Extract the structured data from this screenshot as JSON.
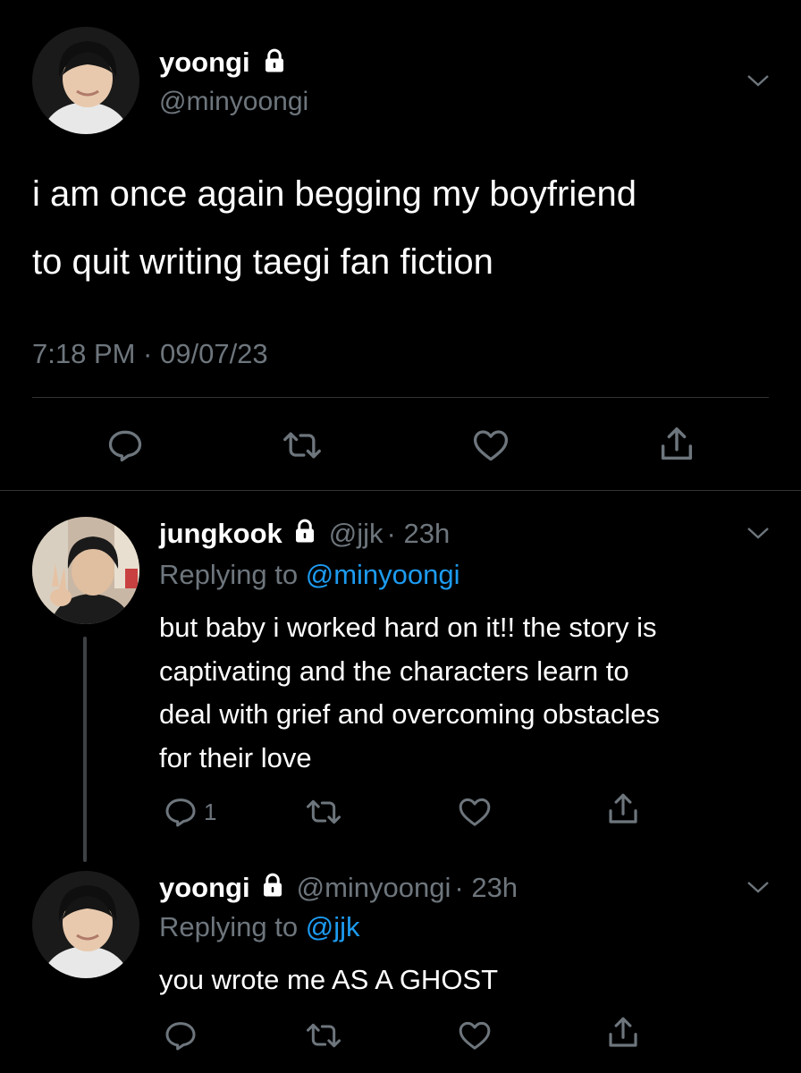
{
  "main_tweet": {
    "display_name": "yoongi",
    "handle": "@minyoongi",
    "text_line1": "i am once again begging my boyfriend",
    "text_line2": "to quit writing taegi fan fiction",
    "timestamp": "7:18 PM · 09/07/23"
  },
  "reply1": {
    "display_name": "jungkook",
    "handle": "@jjk",
    "time": "· 23h",
    "replying_prefix": "Replying to ",
    "replying_handle": "@minyoongi",
    "text_lines": [
      "but baby i worked hard on it!! the story is",
      "captivating and the characters learn to",
      "deal with grief and overcoming obstacles",
      "for their love"
    ],
    "reply_count": "1"
  },
  "reply2": {
    "display_name": "yoongi",
    "handle": "@minyoongi",
    "time": "· 23h",
    "replying_prefix": "Replying to ",
    "replying_handle": "@jjk",
    "text": "you wrote me AS A GHOST"
  },
  "colors": {
    "background": "#000000",
    "text": "#ffffff",
    "secondary": "#6e767d",
    "link": "#1d9bf0",
    "divider": "#2f3336"
  }
}
